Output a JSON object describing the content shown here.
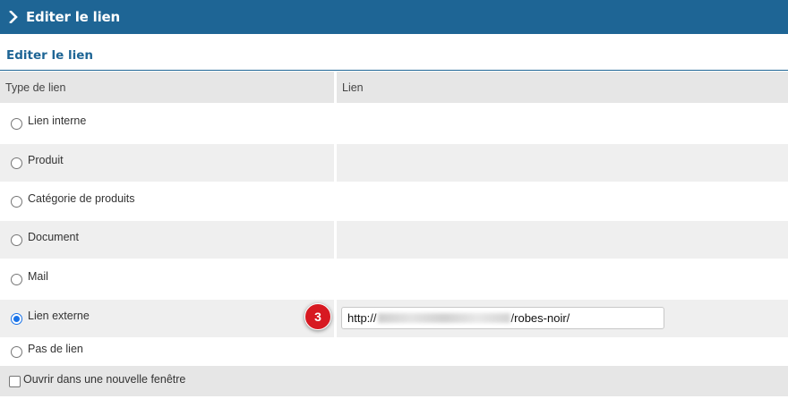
{
  "header": {
    "title": "Editer le lien",
    "icon": "chevron-right-icon"
  },
  "section": {
    "title": "Editer le lien"
  },
  "table": {
    "columns": [
      "Type de lien",
      "Lien"
    ],
    "options": [
      {
        "label": "Lien interne",
        "checked": false
      },
      {
        "label": "Produit",
        "checked": false
      },
      {
        "label": "Catégorie de produits",
        "checked": false
      },
      {
        "label": "Document",
        "checked": false
      },
      {
        "label": "Mail",
        "checked": false
      },
      {
        "label": "Lien externe",
        "checked": true
      },
      {
        "label": "Pas de lien",
        "checked": false
      }
    ]
  },
  "external_link": {
    "value_prefix": "http://",
    "value_suffix": "/robes-noir/",
    "value_obscured": true
  },
  "step_badge": {
    "number": "3",
    "color": "#d71921"
  },
  "new_window": {
    "label": "Ouvrir dans une nouvelle fenêtre",
    "checked": false
  },
  "colors": {
    "brand": "#1e6595",
    "radio_checked": "#1a73e8"
  }
}
